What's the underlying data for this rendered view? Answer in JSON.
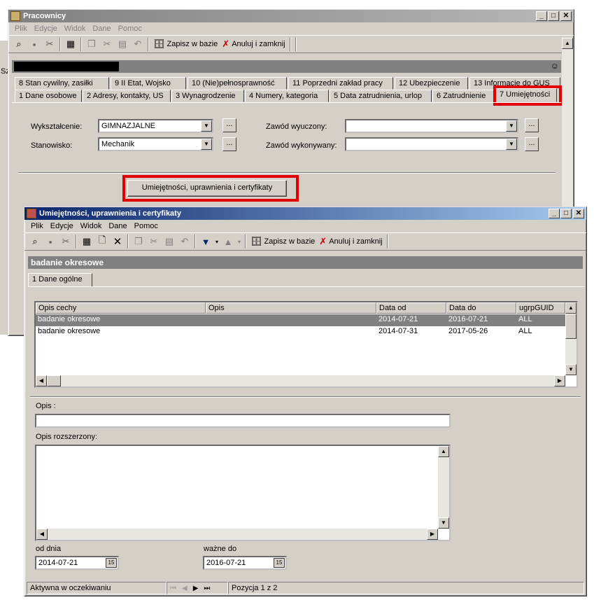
{
  "main_window": {
    "title": "Pracownicy",
    "menu": [
      "Plik",
      "Edycje",
      "Widok",
      "Dane",
      "Pomoc"
    ],
    "toolbar": {
      "save_label": "Zapisz w bazie",
      "cancel_label": "Anuluj i zamknij"
    },
    "left_fragment": "Sz",
    "tabs_row1": [
      "8  Stan cywilny, zasiłki",
      "9  II Etat, Wojsko",
      "10  (Nie)pełnosprawność",
      "11  Poprzedni zakład pracy",
      "12  Ubezpieczenie",
      "13 Informacje do GUS"
    ],
    "tabs_row2": [
      "1 Dane osobowe",
      "2 Adresy, kontakty, US",
      "3  Wynagrodzenie",
      "4  Numery, kategoria",
      "5  Data zatrudnienia, urlop",
      "6  Zatrudnienie",
      "7  Umiejętności"
    ],
    "fields": {
      "education_label": "Wykształcenie:",
      "education_value": "GIMNAZJALNE",
      "position_label": "Stanowisko:",
      "position_value": "Mechanik",
      "learned_label": "Zawód wyuczony:",
      "learned_value": "",
      "performed_label": "Zawód wykonywany:",
      "performed_value": "",
      "dots": "..."
    },
    "skills_button": "Umiejętności, uprawnienia i certyfikaty"
  },
  "child_window": {
    "title": "Umiejętności, uprawnienia i certyfikaty",
    "menu": [
      "Plik",
      "Edycje",
      "Widok",
      "Dane",
      "Pomoc"
    ],
    "toolbar": {
      "save_label": "Zapisz w bazie",
      "cancel_label": "Anuluj i zamknij"
    },
    "header": "badanie okresowe",
    "tab": "1 Dane ogólne",
    "grid": {
      "columns": [
        "Opis cechy",
        "Opis",
        "Data od",
        "Data do",
        "ugrpGUID"
      ],
      "rows": [
        [
          "badanie okresowe",
          "",
          "2014-07-21",
          "2016-07-21",
          "ALL"
        ],
        [
          "badanie okresowe",
          "",
          "2014-07-31",
          "2017-05-26",
          "ALL"
        ]
      ]
    },
    "opis_label": "Opis :",
    "opis_value": "",
    "opis_ext_label": "Opis rozszerzony:",
    "od_dnia_label": "od dnia",
    "od_dnia_value": "2014-07-21",
    "wazne_do_label": "ważne do",
    "wazne_do_value": "2016-07-21",
    "status": {
      "state": "Aktywna w oczekiwaniu",
      "position": "Pozycja 1 z 2"
    }
  },
  "colors": {
    "highlight": "#e00000",
    "selected_row": "#808080",
    "title_active": "#0a246a"
  },
  "icons": [
    "app-icon",
    "minimize-icon",
    "maximize-icon",
    "close-icon",
    "save-icon",
    "cancel-icon",
    "calendar-icon",
    "arrow-down-icon",
    "arrow-up-icon"
  ]
}
